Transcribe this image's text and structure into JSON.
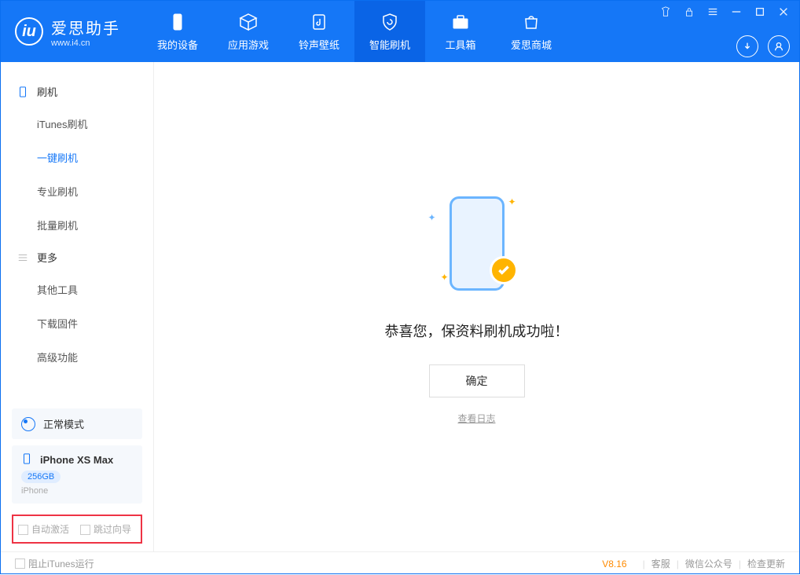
{
  "app": {
    "title": "爱思助手",
    "subtitle": "www.i4.cn"
  },
  "nav": {
    "device": "我的设备",
    "apps": "应用游戏",
    "ringtone": "铃声壁纸",
    "flash": "智能刷机",
    "toolbox": "工具箱",
    "store": "爱思商城"
  },
  "sidebar": {
    "group_flash": "刷机",
    "items_flash": {
      "itunes": "iTunes刷机",
      "oneclick": "一键刷机",
      "pro": "专业刷机",
      "batch": "批量刷机"
    },
    "group_more": "更多",
    "items_more": {
      "other": "其他工具",
      "firmware": "下载固件",
      "advanced": "高级功能"
    }
  },
  "mode": {
    "label": "正常模式"
  },
  "device": {
    "name": "iPhone XS Max",
    "storage": "256GB",
    "type": "iPhone"
  },
  "checks": {
    "auto_activate": "自动激活",
    "skip_guide": "跳过向导"
  },
  "main": {
    "success": "恭喜您，保资料刷机成功啦！",
    "ok": "确定",
    "viewlog": "查看日志"
  },
  "footer": {
    "block_itunes": "阻止iTunes运行",
    "version": "V8.16",
    "service": "客服",
    "wechat": "微信公众号",
    "update": "检查更新"
  }
}
